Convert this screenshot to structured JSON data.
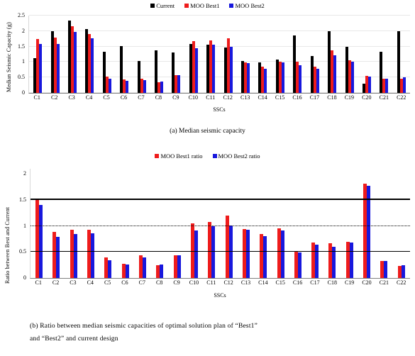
{
  "figure": {
    "caption_a": "(a) Median seismic capacity",
    "caption_b_line1": "(b) Ratio between median seismic capacities of optimal solution plan of “Best1”",
    "caption_b_line2": "and “Best2” and current design"
  },
  "colors": {
    "current": "#000000",
    "best1": "#EE1C1C",
    "best2": "#1818DD",
    "gridline": "#E8E8E8",
    "refline": "#000000"
  },
  "chart_data": [
    {
      "type": "bar",
      "id": "median-seismic-capacity",
      "title": "",
      "xlabel": "SSCs",
      "ylabel": "Median Seismic Capacity (g)",
      "ylim": [
        0,
        2.5
      ],
      "yticks": [
        "0",
        "0.5",
        "1",
        "1.5",
        "2",
        "2.5"
      ],
      "ytick_values": [
        0,
        0.5,
        1,
        1.5,
        2,
        2.5
      ],
      "grid": true,
      "legend_position": "top-center",
      "categories": [
        "C1",
        "C2",
        "C3",
        "C4",
        "C5",
        "C6",
        "C7",
        "C8",
        "C9",
        "C10",
        "C11",
        "C12",
        "C13",
        "C14",
        "C15",
        "C16",
        "C17",
        "C18",
        "C19",
        "C20",
        "C21",
        "C22"
      ],
      "series": [
        {
          "name": "Current",
          "color": "#000000",
          "values": [
            1.13,
            2.0,
            2.33,
            2.06,
            1.34,
            1.51,
            1.03,
            1.38,
            1.3,
            1.58,
            1.55,
            1.47,
            1.04,
            0.99,
            1.08,
            1.86,
            1.2,
            2.0,
            1.5,
            0.3,
            1.34,
            1.99
          ]
        },
        {
          "name": "MOO Best1",
          "color": "#EE1C1C",
          "values": [
            1.74,
            1.79,
            2.15,
            1.91,
            0.53,
            0.43,
            0.45,
            0.35,
            0.58,
            1.67,
            1.69,
            1.76,
            0.99,
            0.85,
            1.02,
            1.0,
            0.84,
            1.37,
            1.06,
            0.55,
            0.45,
            0.46
          ]
        },
        {
          "name": "MOO Best2",
          "color": "#1818DD",
          "values": [
            1.59,
            1.59,
            1.97,
            1.76,
            0.46,
            0.4,
            0.41,
            0.36,
            0.57,
            1.44,
            1.56,
            1.48,
            0.97,
            0.79,
            0.99,
            0.89,
            0.78,
            1.22,
            1.02,
            0.53,
            0.45,
            0.5
          ]
        }
      ]
    },
    {
      "type": "bar",
      "id": "ratio-best-to-current",
      "title": "",
      "xlabel": "SSCs",
      "ylabel": "Ratio between Best and Current",
      "ylim": [
        0,
        2.1
      ],
      "yticks": [
        "0",
        "0.5",
        "1",
        "1.5",
        "2"
      ],
      "ytick_values": [
        0,
        0.5,
        1,
        1.5,
        2
      ],
      "grid": false,
      "legend_position": "top-center",
      "reference_lines": [
        {
          "value": 0.5,
          "style": "solid"
        },
        {
          "value": 1.0,
          "style": "dotted"
        },
        {
          "value": 1.5,
          "style": "solid"
        }
      ],
      "categories": [
        "C1",
        "C2",
        "C3",
        "C4",
        "C5",
        "C6",
        "C7",
        "C8",
        "C9",
        "C10",
        "C11",
        "C12",
        "C13",
        "C14",
        "C15",
        "C16",
        "C17",
        "C18",
        "C19",
        "C20",
        "C21",
        "C22"
      ],
      "series": [
        {
          "name": "MOO Best1 ratio",
          "color": "#EE1C1C",
          "values": [
            1.53,
            0.89,
            0.93,
            0.93,
            0.39,
            0.27,
            0.43,
            0.25,
            0.44,
            1.05,
            1.08,
            1.2,
            0.94,
            0.85,
            0.95,
            0.52,
            0.68,
            0.67,
            0.7,
            1.82,
            0.33,
            0.23
          ]
        },
        {
          "name": "MOO Best2 ratio",
          "color": "#1818DD",
          "values": [
            1.41,
            0.79,
            0.85,
            0.86,
            0.34,
            0.26,
            0.39,
            0.26,
            0.44,
            0.91,
            1.0,
            1.01,
            0.93,
            0.8,
            0.91,
            0.49,
            0.64,
            0.6,
            0.68,
            1.77,
            0.33,
            0.24
          ]
        }
      ]
    }
  ]
}
